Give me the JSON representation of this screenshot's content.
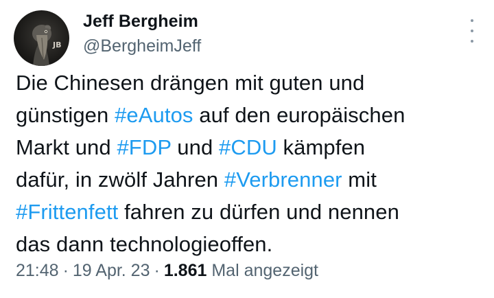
{
  "author": {
    "name": "Jeff Bergheim",
    "handle": "@BergheimJeff",
    "avatar_badge": "JB"
  },
  "tweet_lines": [
    [
      {
        "text": "Die Chinesen drängen mit guten und",
        "type": "text"
      }
    ],
    [
      {
        "text": "günstigen ",
        "type": "text"
      },
      {
        "text": "#eAutos",
        "type": "hashtag"
      },
      {
        "text": " auf den europäischen",
        "type": "text"
      }
    ],
    [
      {
        "text": "Markt und ",
        "type": "text"
      },
      {
        "text": "#FDP",
        "type": "hashtag"
      },
      {
        "text": " und ",
        "type": "text"
      },
      {
        "text": "#CDU",
        "type": "hashtag"
      },
      {
        "text": " kämpfen",
        "type": "text"
      }
    ],
    [
      {
        "text": "dafür, in zwölf Jahren ",
        "type": "text"
      },
      {
        "text": "#Verbrenner",
        "type": "hashtag"
      },
      {
        "text": " mit",
        "type": "text"
      }
    ],
    [
      {
        "text": "#Frittenfett",
        "type": "hashtag"
      },
      {
        "text": " fahren zu dürfen und nennen",
        "type": "text"
      }
    ],
    [
      {
        "text": "das dann technologieoffen.",
        "type": "text"
      }
    ]
  ],
  "meta": {
    "time": "21:48",
    "separator": "·",
    "date": "19 Apr. 23",
    "views_count": "1.861",
    "views_label": "Mal angezeigt"
  },
  "colors": {
    "link": "#1d9bf0",
    "secondary_text": "#536471",
    "primary_text": "#0f1419",
    "background": "#ffffff"
  },
  "icons": {
    "more": "more-options-icon"
  }
}
